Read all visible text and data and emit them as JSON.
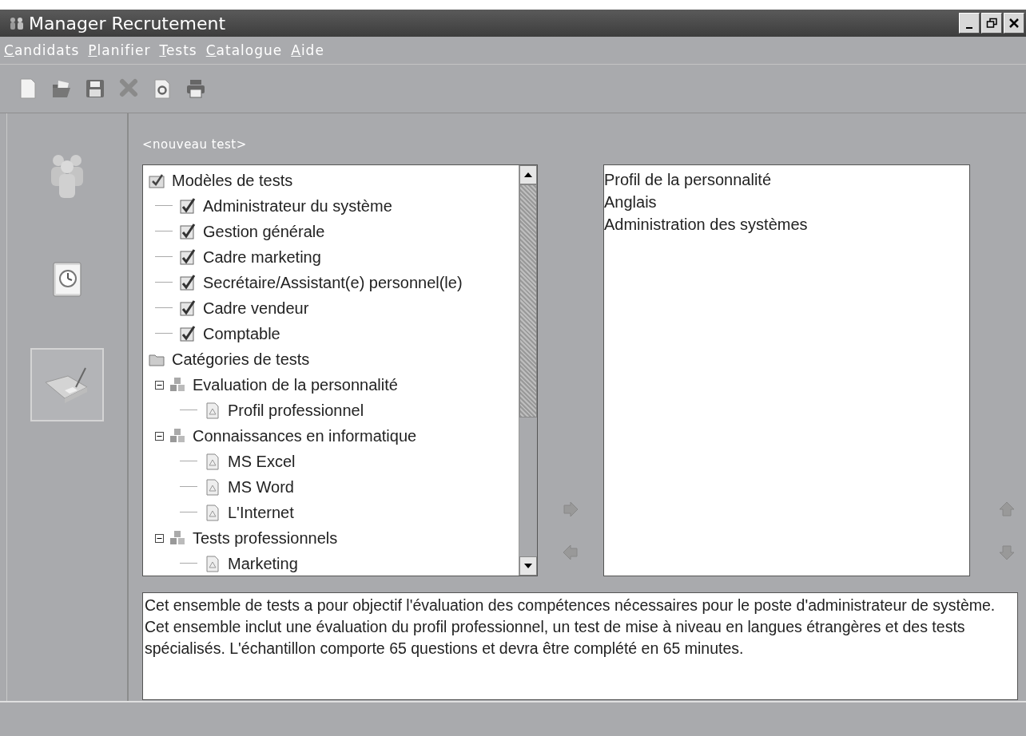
{
  "window": {
    "title": "Manager Recrutement",
    "controls": [
      {
        "kind": "minimize"
      },
      {
        "kind": "restore"
      },
      {
        "kind": "close"
      }
    ]
  },
  "menu": [
    "Candidats",
    "Planifier",
    "Tests",
    "Catalogue",
    "Aide"
  ],
  "toolbar": [
    {
      "kind": "new"
    },
    {
      "kind": "open"
    },
    {
      "kind": "save"
    },
    {
      "kind": "delete"
    },
    {
      "kind": "settings"
    },
    {
      "kind": "print"
    }
  ],
  "sidebar": {
    "items": [
      {
        "kind": "candidates",
        "selected": false
      },
      {
        "kind": "schedule",
        "selected": false
      },
      {
        "kind": "tests",
        "selected": true
      }
    ]
  },
  "test_name": "<nouveau test>",
  "tree": {
    "items": [
      {
        "kind": "templates",
        "label": "Modèles de tests",
        "children": [
          {
            "kind": "template",
            "label": "Administrateur du système",
            "checked": true
          },
          {
            "kind": "template",
            "label": "Gestion générale",
            "checked": true
          },
          {
            "kind": "template",
            "label": "Cadre marketing",
            "checked": true
          },
          {
            "kind": "template",
            "label": "Secrétaire/Assistant(e) personnel(le)",
            "checked": true
          },
          {
            "kind": "template",
            "label": "Cadre vendeur",
            "checked": true
          },
          {
            "kind": "template",
            "label": "Comptable",
            "checked": true
          }
        ]
      },
      {
        "kind": "folder",
        "label": "Catégories de tests",
        "children": [
          {
            "kind": "category",
            "label": "Evaluation de la personnalité",
            "expanded": true,
            "children": [
              {
                "kind": "test",
                "label": "Profil professionnel"
              }
            ]
          },
          {
            "kind": "category",
            "label": "Connaissances en informatique",
            "expanded": true,
            "children": [
              {
                "kind": "test",
                "label": "MS Excel"
              },
              {
                "kind": "test",
                "label": "MS Word"
              },
              {
                "kind": "test",
                "label": "L'Internet"
              }
            ]
          },
          {
            "kind": "category",
            "label": "Tests professionnels",
            "expanded": true,
            "children": [
              {
                "kind": "test",
                "label": "Marketing"
              }
            ]
          }
        ]
      }
    ]
  },
  "transfer_buttons": [
    {
      "kind": "add"
    },
    {
      "kind": "remove"
    }
  ],
  "selected_tests": [
    "Profil de la personnalité",
    "Anglais",
    "Administration des systèmes"
  ],
  "order_buttons": [
    {
      "kind": "up"
    },
    {
      "kind": "down"
    }
  ],
  "description": "Cet ensemble de tests a pour objectif l'évaluation des compétences nécessaires pour le poste d'administrateur de système. Cet ensemble inclut une évaluation du profil professionnel, un test de mise à niveau en langues étrangères et des tests spécialisés. L'échantillon comporte 65 questions et devra être complété en 65 minutes."
}
